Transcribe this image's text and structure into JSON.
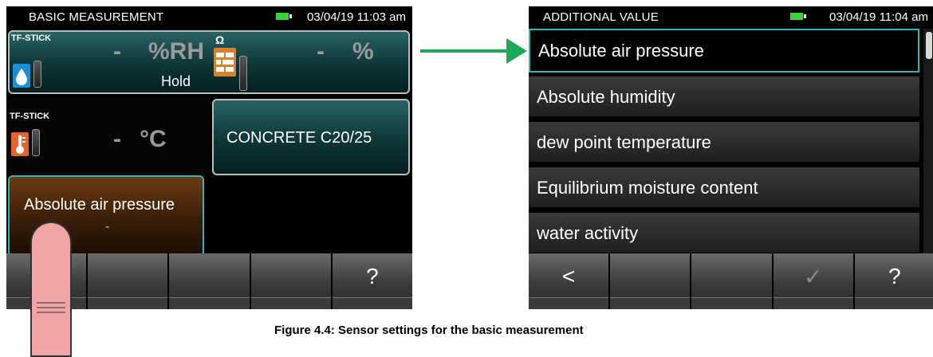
{
  "left_screen": {
    "status": {
      "title": "BASIC MEASUREMENT",
      "datetime": "03/04/19 11:03 am"
    },
    "tile_humidity": {
      "sensor_label": "TF-STICK",
      "value": "-",
      "unit": "%RH",
      "note": "Hold"
    },
    "tile_material": {
      "symbol": "Ω",
      "value": "-",
      "unit": "%"
    },
    "tile_temperature": {
      "sensor_label": "TF-STICK",
      "value": "-",
      "unit": "°C"
    },
    "tile_material_name": {
      "label": "CONCRETE C20/25"
    },
    "tile_additional": {
      "label": "Absolute air pressure",
      "value": "-"
    },
    "softkeys": [
      "",
      "",
      "",
      "",
      "?"
    ]
  },
  "right_screen": {
    "status": {
      "title": "ADDITIONAL VALUE",
      "datetime": "03/04/19 11:04 am"
    },
    "items": [
      "Absolute air pressure",
      "Absolute humidity",
      "dew point temperature",
      "Equilibrium moisture content",
      "water activity"
    ],
    "selected_index": 0,
    "softkeys": [
      "<",
      "",
      "",
      "✓",
      "?"
    ]
  },
  "caption": "Figure 4.4: Sensor settings for the basic measurement",
  "colors": {
    "accent": "#2fb6b8",
    "arrow": "#1ea857",
    "battery": "#3bd23b"
  }
}
